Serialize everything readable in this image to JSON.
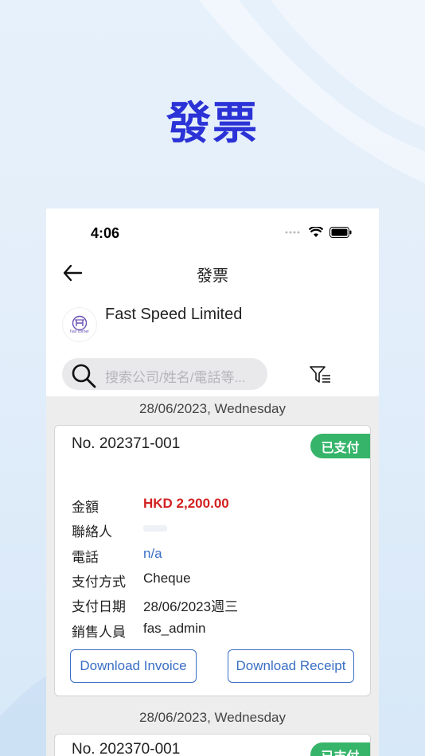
{
  "hero_title": "發票",
  "status_bar": {
    "time": "4:06"
  },
  "nav": {
    "title": "發票"
  },
  "company": {
    "name": "Fast Speed Limited",
    "logo_text": "hair corner"
  },
  "search": {
    "placeholder": "搜索公司/姓名/電話等..."
  },
  "groups": [
    {
      "date": "28/06/2023, Wednesday",
      "invoice": {
        "number": "No. 202371-001",
        "status": "已支付",
        "amount_label": "金額",
        "amount": "HKD 2,200.00",
        "contact_label": "聯絡人",
        "phone_label": "電話",
        "phone": "n/a",
        "method_label": "支付方式",
        "method": "Cheque",
        "paid_date_label": "支付日期",
        "paid_date": "28/06/2023週三",
        "sales_label": "銷售人員",
        "sales": "fas_admin",
        "download_invoice": "Download Invoice",
        "download_receipt": "Download Receipt"
      }
    },
    {
      "date": "28/06/2023, Wednesday",
      "invoice": {
        "number": "No. 202370-001",
        "status": "已支付"
      }
    }
  ],
  "colors": {
    "accent": "#2b32d6",
    "paid": "#36b56a",
    "amount": "#d32121",
    "link": "#3a6fc4"
  },
  "icons": [
    "back-arrow-icon",
    "search-icon",
    "filter-icon",
    "wifi-icon",
    "battery-icon",
    "signal-icon"
  ]
}
